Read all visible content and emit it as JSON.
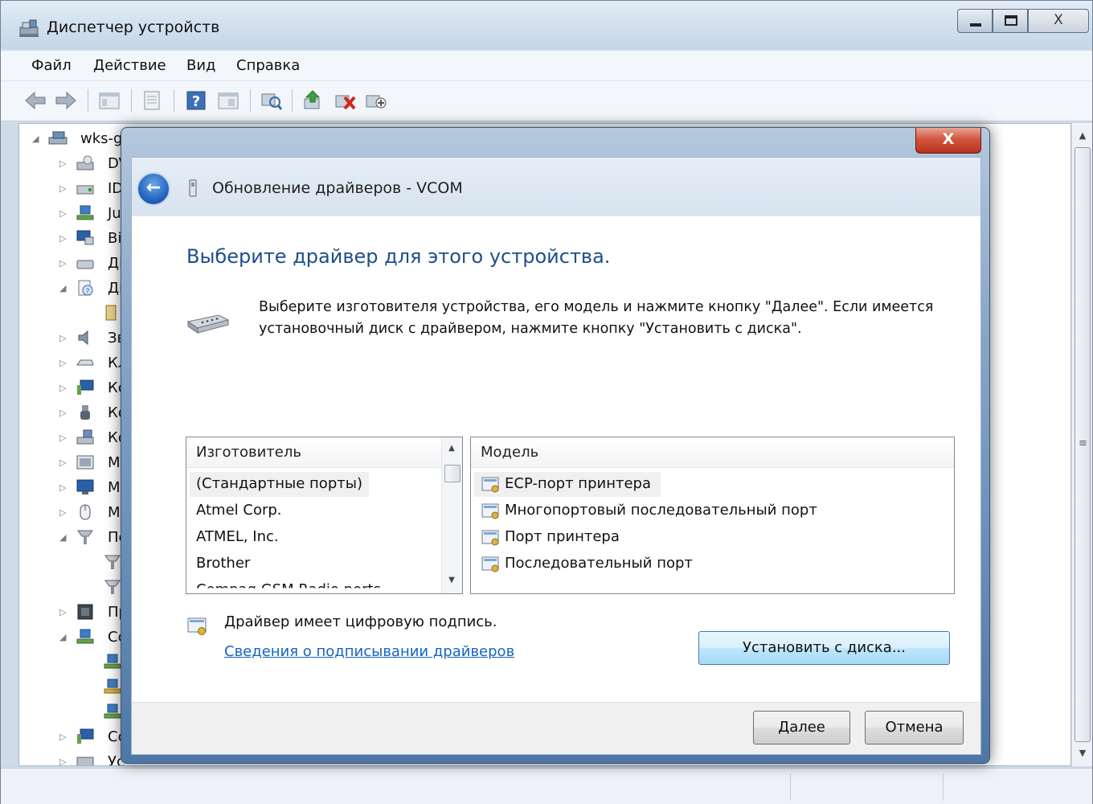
{
  "device_manager": {
    "title": "Диспетчер устройств",
    "close_glyph": "X",
    "menu": [
      "Файл",
      "Действие",
      "Вид",
      "Справка"
    ],
    "tree_root": "wks-g",
    "tree_items": [
      "DV",
      "ID",
      "Ju",
      "Bi",
      "Дi",
      "Дi",
      "Зв",
      "Кл",
      "Кс",
      "Кс",
      "Кс",
      "Мс",
      "Мс",
      "Мс",
      "Пс",
      "Пр",
      "Сс",
      "Сс",
      "Ус"
    ],
    "scroll_grip": "≡"
  },
  "dialog": {
    "close_glyph": "X",
    "back_glyph": "←",
    "title": "Обновление драйверов - VCOM",
    "heading": "Выберите драйвер для этого устройства.",
    "instruction": "Выберите изготовителя устройства, его модель и нажмите кнопку \"Далее\". Если имеется установочный диск с  драйвером, нажмите кнопку \"Установить с диска\".",
    "manufacturer_header": "Изготовитель",
    "manufacturers": [
      "(Стандартные порты)",
      "Atmel Corp.",
      "ATMEL, Inc.",
      "Brother",
      "Compaq GSM Radio ports"
    ],
    "model_header": "Модель",
    "models": [
      "ECP-порт принтера",
      "Многопортовый последовательный порт",
      "Порт принтера",
      "Последовательный порт"
    ],
    "signed_text": "Драйвер имеет цифровую подпись.",
    "sign_link": "Сведения о подписывании драйверов",
    "have_disk_button": "Установить с диска...",
    "next_button": "Далее",
    "cancel_button": "Отмена"
  }
}
